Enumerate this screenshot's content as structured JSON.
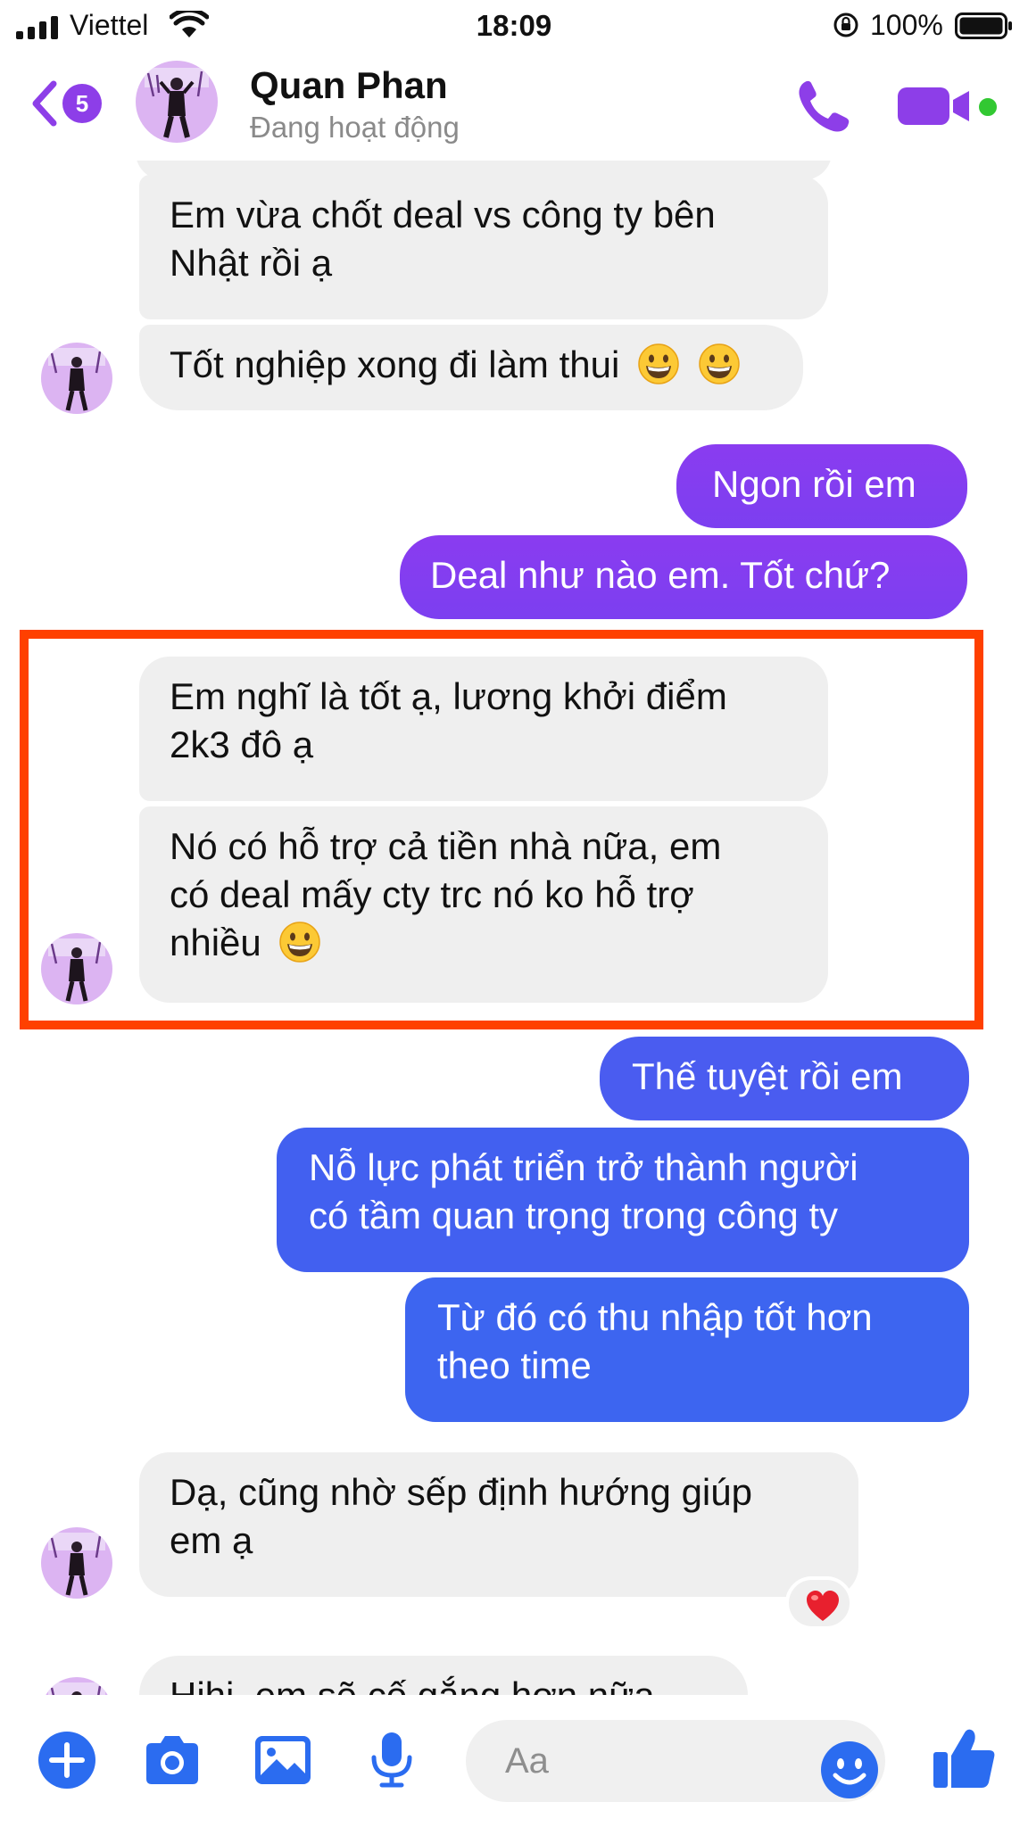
{
  "status_bar": {
    "carrier": "Viettel",
    "time": "18:09",
    "battery": "100%"
  },
  "header": {
    "unread_count": "5",
    "contact_name": "Quan Phan",
    "contact_status": "Đang hoạt động"
  },
  "colors": {
    "accent": "#8d3ee8",
    "purple_bubble": "#8a3cf0",
    "blue_bubble": "#3d63f0",
    "incoming_bubble": "#efefef",
    "highlight": "#ff4000"
  },
  "messages": [
    {
      "sender": "contact",
      "lines": [
        "Em vừa chốt deal vs công ty bên",
        "Nhật rồi ạ"
      ]
    },
    {
      "sender": "contact",
      "lines": [
        "Tốt nghiệp xong đi làm thui"
      ],
      "emoji": "grinning-face-icon x2"
    },
    {
      "sender": "me",
      "lines": [
        "Ngon rồi em"
      ]
    },
    {
      "sender": "me",
      "lines": [
        "Deal như nào em. Tốt chứ?"
      ]
    },
    {
      "sender": "contact",
      "lines": [
        "Em nghĩ là tốt ạ, lương khởi điểm",
        "2k3 đô ạ"
      ]
    },
    {
      "sender": "contact",
      "lines": [
        "Nó có hỗ trợ cả tiền nhà nữa, em",
        "có deal mấy cty trc nó ko hỗ trợ",
        "nhiều"
      ],
      "emoji": "grinning-face-icon"
    },
    {
      "sender": "me",
      "lines": [
        "Thế tuyệt rồi em"
      ]
    },
    {
      "sender": "me",
      "lines": [
        "Nỗ lực phát triển trở thành người",
        "có tầm quan trọng trong công ty"
      ]
    },
    {
      "sender": "me",
      "lines": [
        "Từ đó có thu nhập tốt hơn",
        "theo time"
      ]
    },
    {
      "sender": "contact",
      "lines": [
        "Dạ, cũng nhờ sếp định hướng giúp",
        "em ạ"
      ],
      "reaction": "heart-icon"
    },
    {
      "sender": "contact",
      "lines": [
        "Hihi, em sẽ cố gắng hơn nữa"
      ]
    }
  ],
  "composer": {
    "placeholder": "Aa"
  }
}
